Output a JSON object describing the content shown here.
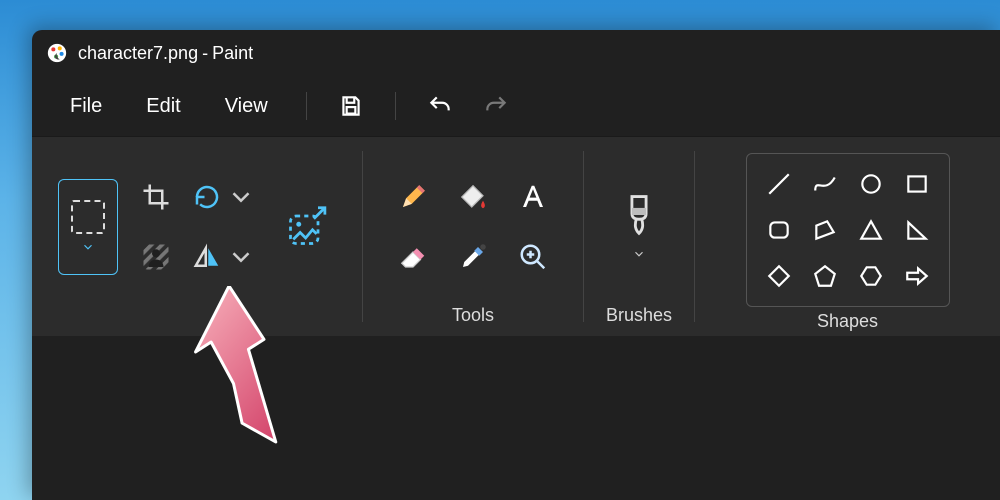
{
  "title": {
    "filename": "character7.png",
    "separator": " - ",
    "app": "Paint"
  },
  "menubar": {
    "file": "File",
    "edit": "Edit",
    "view": "View"
  },
  "ribbon": {
    "tools_label": "Tools",
    "brushes_label": "Brushes",
    "shapes_label": "Shapes"
  }
}
